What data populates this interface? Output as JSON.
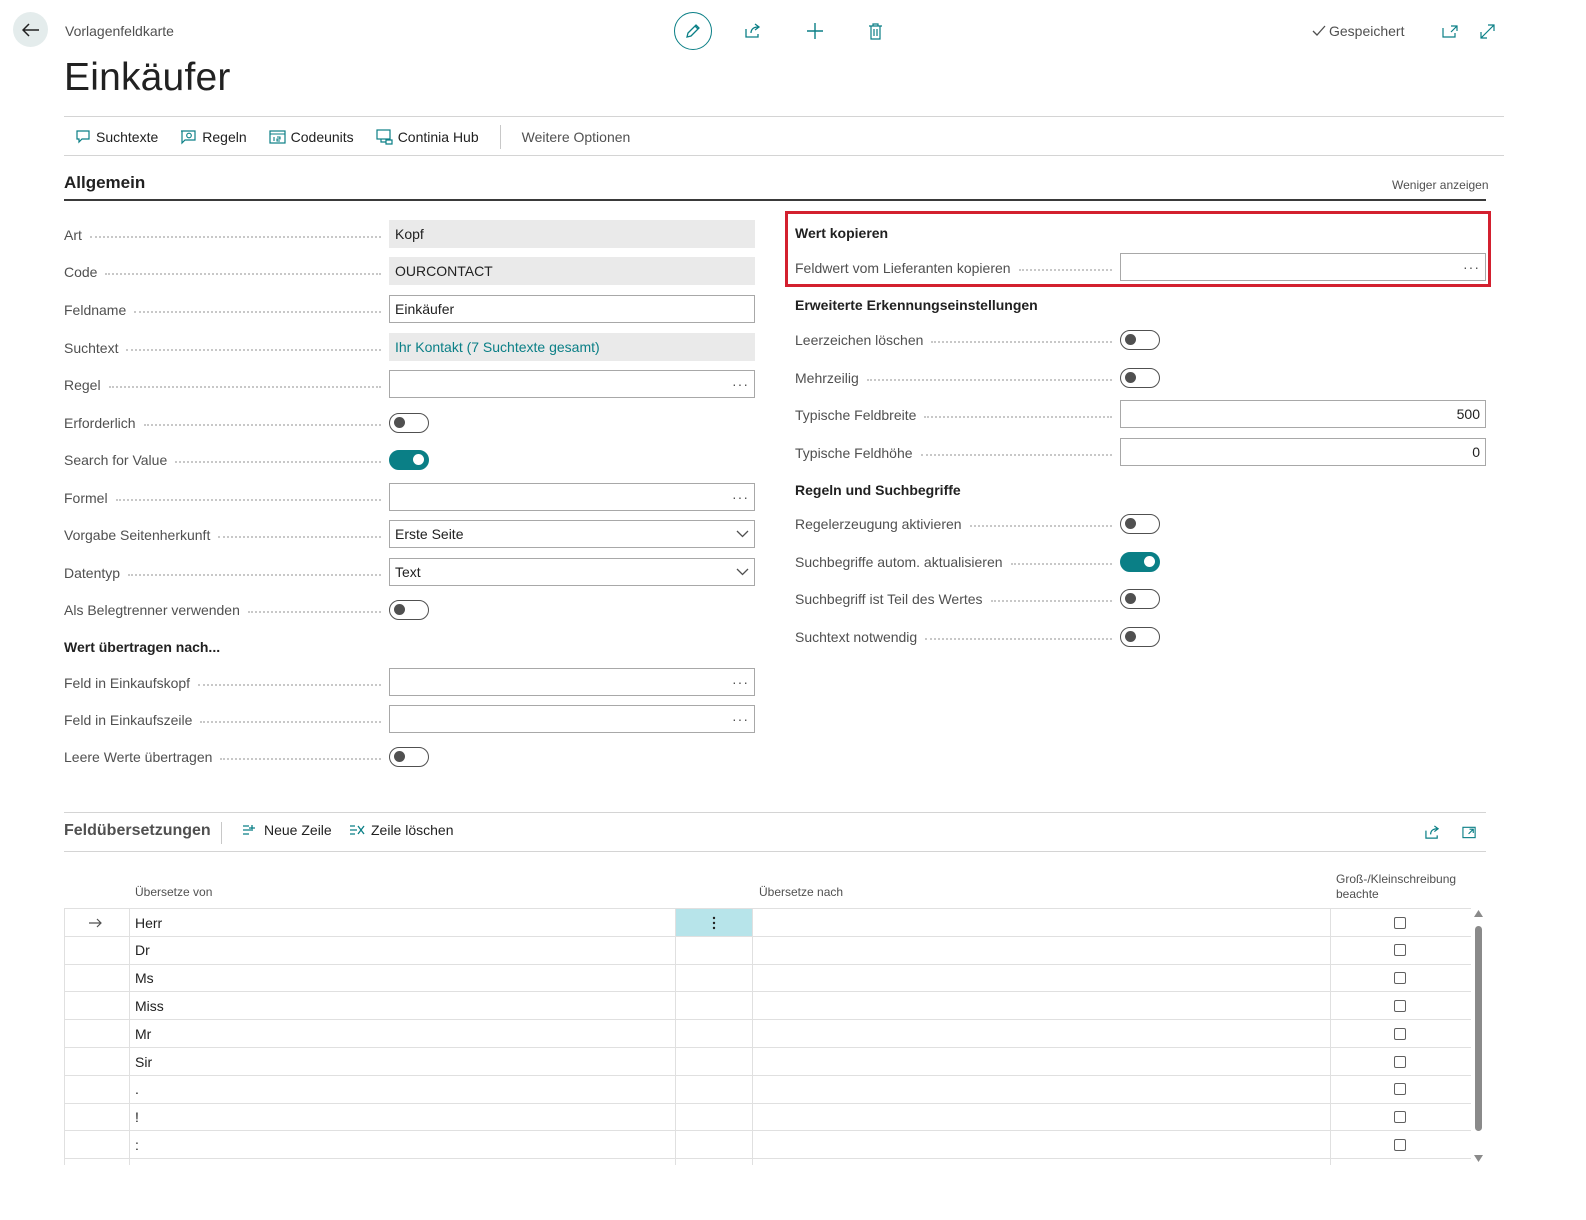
{
  "header": {
    "breadcrumb": "Vorlagenfeldkarte",
    "title": "Einkäufer",
    "saved_label": "Gespeichert"
  },
  "actions": [
    {
      "label": "Suchtexte",
      "icon": "speech-bubble-icon"
    },
    {
      "label": "Regeln",
      "icon": "rules-icon"
    },
    {
      "label": "Codeunits",
      "icon": "codeunit-icon"
    },
    {
      "label": "Continia Hub",
      "icon": "hub-icon"
    }
  ],
  "more_options": "Weitere Optionen",
  "general": {
    "title": "Allgemein",
    "show_less": "Weniger anzeigen",
    "left_fields": {
      "art": {
        "label": "Art",
        "value": "Kopf"
      },
      "code": {
        "label": "Code",
        "value": "OURCONTACT"
      },
      "feldname": {
        "label": "Feldname",
        "value": "Einkäufer"
      },
      "suchtext": {
        "label": "Suchtext",
        "value": "Ihr Kontakt (7 Suchtexte gesamt)"
      },
      "regel": {
        "label": "Regel",
        "value": ""
      },
      "erforderlich": {
        "label": "Erforderlich",
        "on": false
      },
      "search_for_value": {
        "label": "Search for Value",
        "on": true
      },
      "formel": {
        "label": "Formel",
        "value": ""
      },
      "seitenherkunft": {
        "label": "Vorgabe Seitenherkunft",
        "value": "Erste Seite"
      },
      "datentyp": {
        "label": "Datentyp",
        "value": "Text"
      },
      "belegtrenner": {
        "label": "Als Belegtrenner verwenden",
        "on": false
      }
    },
    "transfer_group": "Wert übertragen nach...",
    "transfer_fields": {
      "einkaufskopf": {
        "label": "Feld in Einkaufskopf",
        "value": ""
      },
      "einkaufszeile": {
        "label": "Feld in Einkaufszeile",
        "value": ""
      },
      "leere_werte": {
        "label": "Leere Werte übertragen",
        "on": false
      }
    },
    "copy_group": "Wert kopieren",
    "copy_field": {
      "label": "Feldwert vom Lieferanten kopieren",
      "value": ""
    },
    "extended_group": "Erweiterte Erkennungseinstellungen",
    "extended_fields": {
      "leerzeichen": {
        "label": "Leerzeichen löschen",
        "on": false
      },
      "mehrzeilig": {
        "label": "Mehrzeilig",
        "on": false
      },
      "feldbreite": {
        "label": "Typische Feldbreite",
        "value": "500"
      },
      "feldhoehe": {
        "label": "Typische Feldhöhe",
        "value": "0"
      }
    },
    "rules_group": "Regeln und Suchbegriffe",
    "rules_fields": {
      "regelerzeugung": {
        "label": "Regelerzeugung aktivieren",
        "on": false
      },
      "suchbegriffe_auto": {
        "label": "Suchbegriffe autom. aktualisieren",
        "on": true
      },
      "suchbegriff_teil": {
        "label": "Suchbegriff ist Teil des Wertes",
        "on": false
      },
      "suchtext_notwendig": {
        "label": "Suchtext notwendig",
        "on": false
      }
    }
  },
  "translations": {
    "title": "Feldübersetzungen",
    "new_line": "Neue Zeile",
    "delete_line": "Zeile löschen",
    "col_from": "Übersetze von",
    "col_to": "Übersetze nach",
    "col_case_1": "Groß-/Kleinschreibung",
    "col_case_2": "beachte",
    "rows": [
      {
        "from": "Herr",
        "to": "",
        "case": false
      },
      {
        "from": "Dr",
        "to": "",
        "case": false
      },
      {
        "from": "Ms",
        "to": "",
        "case": false
      },
      {
        "from": "Miss",
        "to": "",
        "case": false
      },
      {
        "from": "Mr",
        "to": "",
        "case": false
      },
      {
        "from": "Sir",
        "to": "",
        "case": false
      },
      {
        "from": ".",
        "to": "",
        "case": false
      },
      {
        "from": "!",
        "to": "",
        "case": false
      },
      {
        "from": ":",
        "to": "",
        "case": false
      }
    ]
  },
  "colors": {
    "accent": "#0a7f86",
    "highlight": "#d3202f"
  }
}
